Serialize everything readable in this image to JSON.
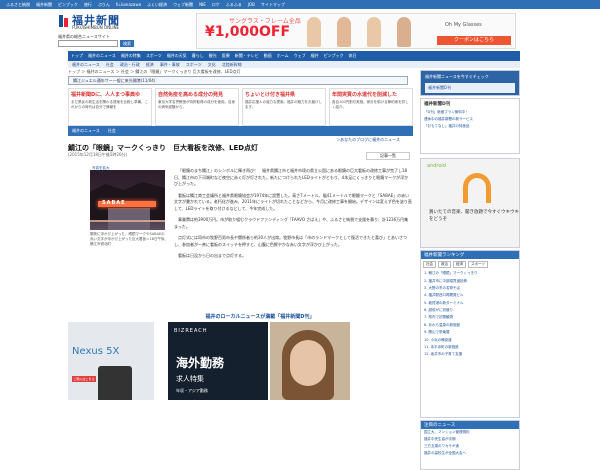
{
  "topbar": {
    "items": [
      "ふるさと納税",
      "福井新聞",
      "ピンプック",
      "旅行",
      "ぷりん",
      "fu.kanazawa",
      "ふくい経済",
      "ウェブ新聞",
      "NIE",
      "ロケ",
      "ふるふる",
      "JOB",
      "サイトマップ"
    ]
  },
  "logo": {
    "name": "福井新聞",
    "en": "FUKUISHIMBUN ONLINE",
    "tagline": "福井県の総合ニュースサイト"
  },
  "search": {
    "placeholder": "",
    "button": "検索"
  },
  "top_ad": {
    "t1": "サングラス・フレーム全品",
    "price": "¥1,000OFF",
    "brand": "Oh My Glasses",
    "coupon": "クーポンはこちら"
  },
  "nav": {
    "items": [
      "トップ",
      "福井のニュース",
      "福井の特集",
      "スポーツ",
      "福井の天気",
      "暮らし",
      "観光",
      "医療",
      "新聞・テレビ",
      "動画",
      "ホーム",
      "ウェブ",
      "福井",
      "ピンプック",
      "休日"
    ]
  },
  "subnav": {
    "items": [
      "福井のニュース",
      "社会",
      "政治・行政",
      "経済",
      "事件・事故",
      "スポーツ",
      "文化",
      "北陸新幹線"
    ]
  },
  "breadcrumb": "トップ ＞ 福井のニュース ＞ 社会 ＞ 鯖江の「眼鏡」マークくっきり 巨大看板を改修、LED点灯",
  "alert": "鯖江ジュエル通年サー一般に来光開港(11/04)",
  "promos": [
    {
      "head": "福井新聞Dに、人人まつ事典ゆ",
      "line": "まだ県民の新生活を関わる提案を比較し準備。これからの時代は自分で情報を"
    },
    {
      "head": "自然免疫を高める成分の発見",
      "line": "東京大学名誉教授が特許取得の成分を使用。自身の病気経験から。"
    },
    {
      "head": "ちょいとけ付き福井県",
      "line": "福井応援人の強力な提案。福井の魅力をお届けします。"
    },
    {
      "head": "年間実質の水道代を削減した",
      "line": "各自100円割引実施。家計を助ける節約術を詳しく紹介。"
    }
  ],
  "section": {
    "items": [
      "福井のニュース",
      "社会"
    ]
  },
  "more_link": "＞あなたのブログに福井のニュース",
  "article": {
    "title": "鯖江の「眼鏡」マークくっきり　巨大看板を改修、LED点灯",
    "date": "(2015年12月18日午後5時20分)",
    "share": "記事一覧",
    "photo_zoom": "写真を拡大",
    "sign_text": "SABAE",
    "caption": "闇夜に浮かび上がった、眼鏡マークやSABAEの赤い文字が浮かび上がった巨大看板＝18日午後、鯖江市嶺北町",
    "paragraphs": [
      "「眼鏡のまち鯖江」のシンボルに輝き再び！　福井県鯖江市と福井市境の県立公園にある眼鏡の巨大看板の改修工事が完了し18日、鯖江市の下河端町など夜空に赤く灯が灯された。新たにつけられたLEDライトがともり、4本足にくっきりと眼鏡マークが浮かび上がった。",
      "看板は鯖江商工会議所と福井県眼鏡協会が1974年に設置した。高さ7メートル、幅41メートルで眼鏡マークと「SABAE」の赤い文字が書かれている。老朽化が進み、2011年にライトが切れたことなどから、今月に改修工事を開始。デザインは変えず色を塗り直して、LEDライトを取り付けるなどして、今年完成した。",
      "事業費は約3900万円。市が取り組むクラウドファンディング「FAAVO さばえ」や、ふるさと納税で支援を募り、計1236万円集まった。",
      "点灯式には同市の牧野百男市長や関係者ら約30人が出席。牧野市長は「市のランドマークとして復活できたと喜び」とあいさつし、参加者が一斉に看板のスイッチを押すと、山腹に色鮮やかな赤い文字が浮かび上がった。",
      "看板は日没から日の出まで点灯する。"
    ]
  },
  "ribbon": "福井のローカルニュースが満載「福井新聞D刊」",
  "ads": {
    "nexus": {
      "name": "Nexus 5X",
      "sub": "Google",
      "btn": "ご購入はこちら"
    },
    "bizreach": {
      "logo": "BIZREACH",
      "l1": "海外勤務",
      "l2": "求人特集",
      "l3": "年収・アジア勤務"
    }
  },
  "right": {
    "banner_title": "福井新聞ニュースを今すぐチェック",
    "banner_btn": "福井新聞D刊",
    "news_head": "福井新聞D刊",
    "news_items": [
      "「D刊」紙面プラン無料中！",
      "連休中の福井新聞の新サービス",
      "「おもてなし」福井の特産品"
    ],
    "android": "android",
    "android_text": "買いたての音楽、聞き放題で今すぐウキウキをどうぞ",
    "ranking_head": "福井新聞ランキング",
    "tabs": [
      "社会",
      "政治",
      "経済",
      "スポーツ"
    ],
    "ranking": [
      "1. 鯖江の「眼鏡」マークくっきり",
      "2. 福井市に中部縦貫道延伸",
      "3. 大野の冬の名物そば",
      "4. 福井駅西口再開発ビル",
      "5. 敦賀港の新ターミナル",
      "6. 越前がに初競り",
      "7. 県内で初雪観測",
      "8. あわら温泉の新旅館",
      "9. 勝山で恐竜展",
      "10. 小浜の鯖街道",
      "11. 永平寺町の新施設",
      "12. 坂井市の子育て支援"
    ],
    "latest_head": "注目のニュース",
    "latest": [
      "国立大、マンション管理規約",
      "福井中央生協が次期",
      "三方五湖のワカサギ漁",
      "福井の高校生が全国大会へ"
    ]
  },
  "colors": {
    "accent": "#2f6fb5",
    "nav": "#1f5da8",
    "ad_red": "#e23"
  }
}
